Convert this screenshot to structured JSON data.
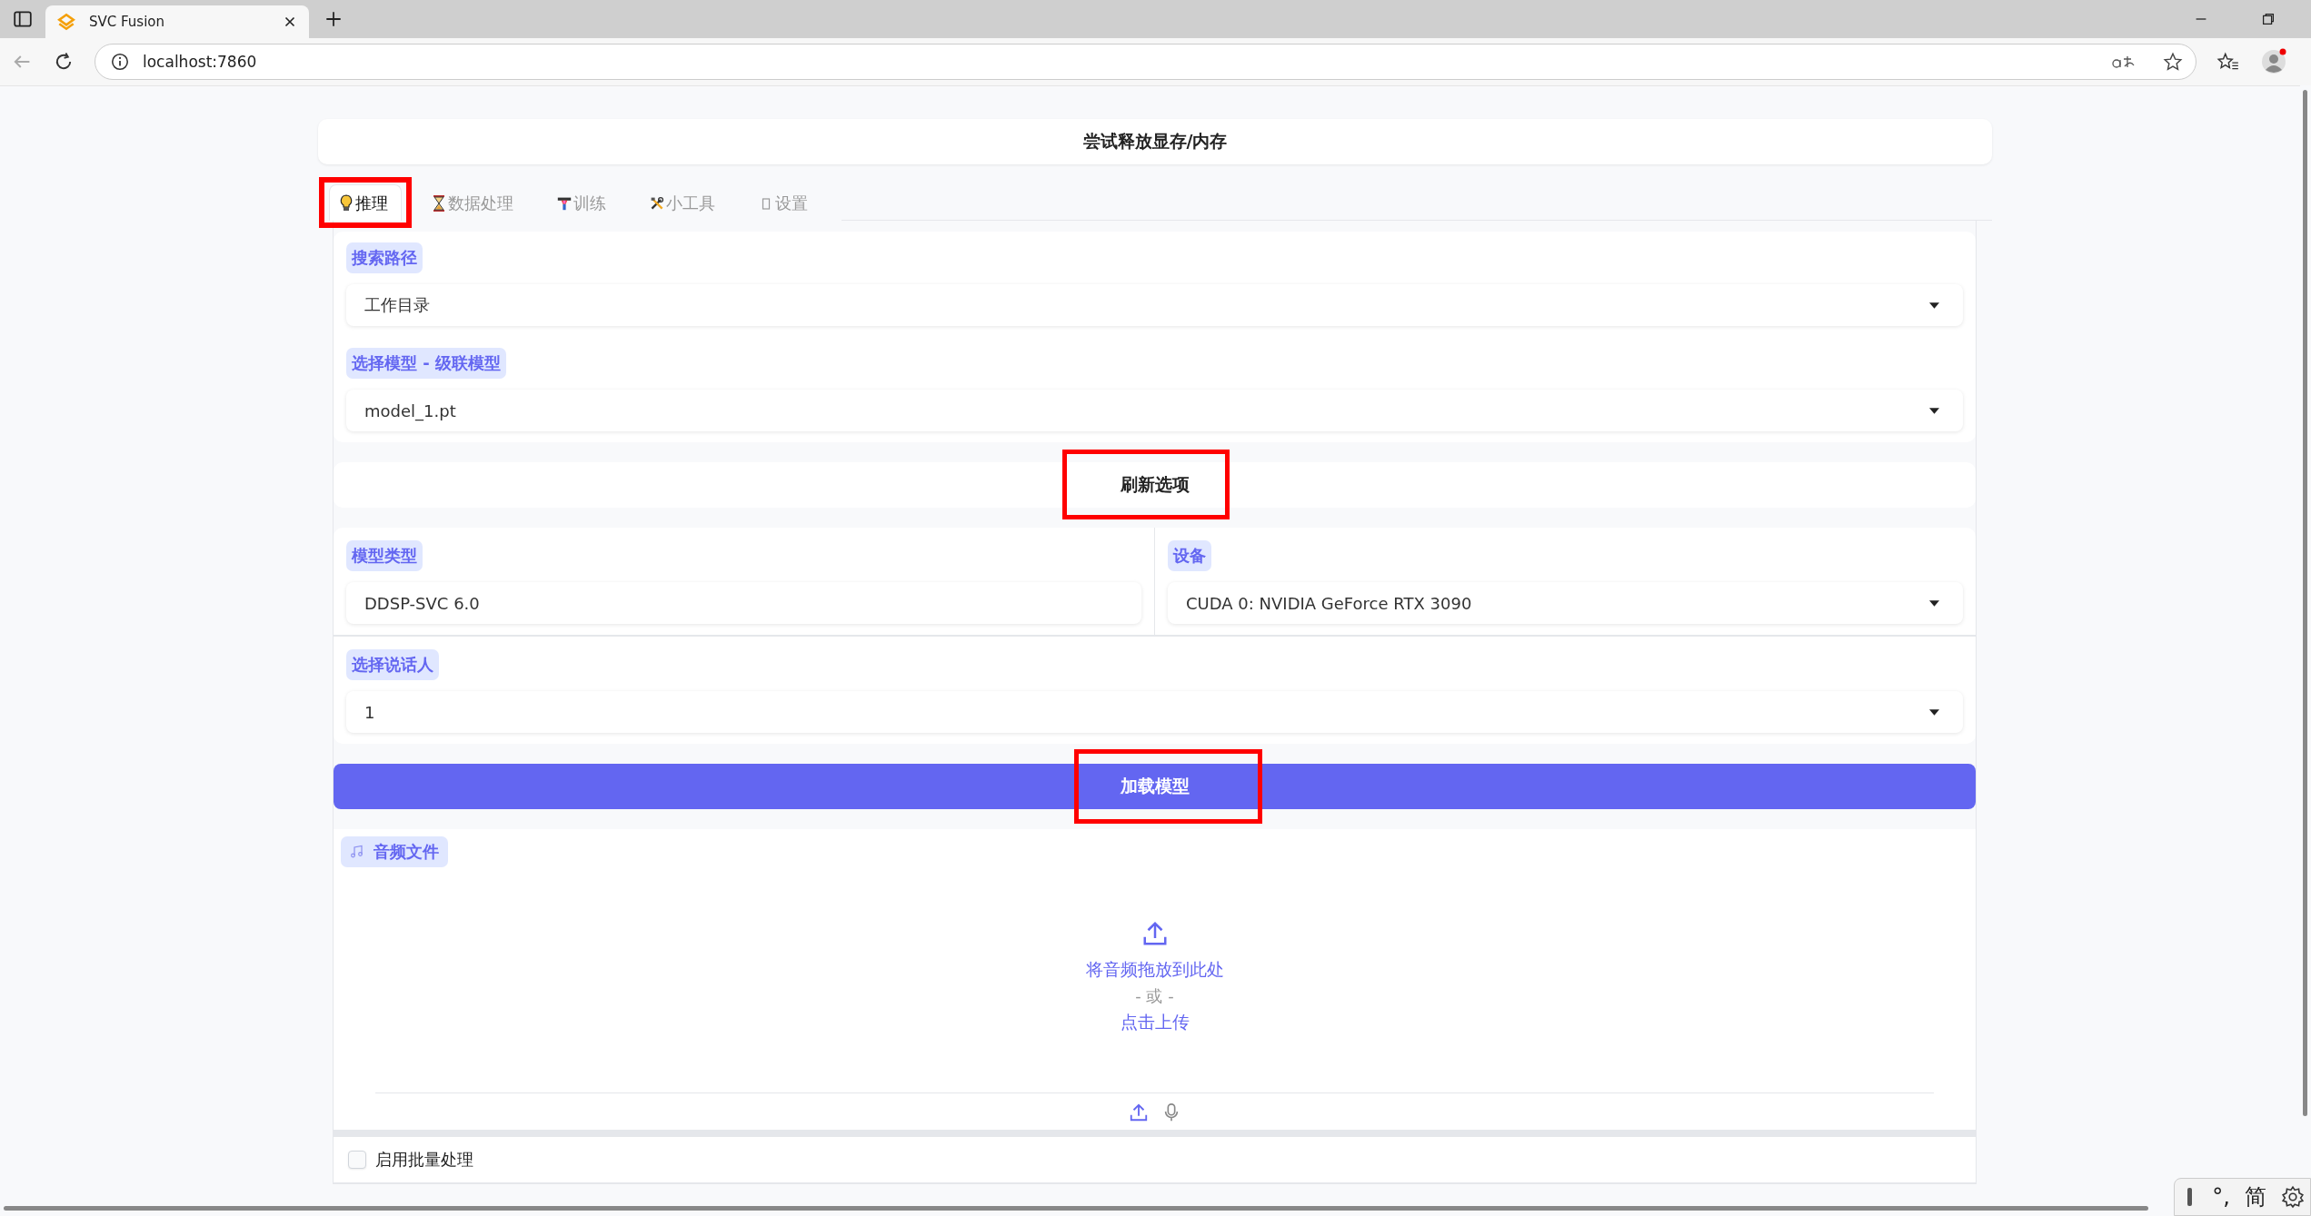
{
  "browser": {
    "tab_title": "SVC Fusion",
    "url": "localhost:7860"
  },
  "free_memory_button": {
    "label": "尝试释放显存/内存"
  },
  "tabs": [
    {
      "label": "推理",
      "selected": true,
      "highlighted": true
    },
    {
      "label": "数据处理",
      "selected": false,
      "highlighted": false
    },
    {
      "label": "训练",
      "selected": false,
      "highlighted": false
    },
    {
      "label": "小工具",
      "selected": false,
      "highlighted": false
    },
    {
      "label": "设置",
      "selected": false,
      "highlighted": false
    }
  ],
  "model_source": [
    {
      "label": "搜索路径",
      "value": "工作目录",
      "kind": "dropdown"
    },
    {
      "label": "选择模型 - 级联模型",
      "value": "model_1.pt",
      "kind": "dropdown"
    }
  ],
  "refresh_button": {
    "label": "刷新选项",
    "highlighted": true
  },
  "model_info": [
    {
      "label": "模型类型",
      "value": "DDSP-SVC 6.0",
      "kind": "text"
    },
    {
      "label": "设备",
      "value": "CUDA 0: NVIDIA GeForce RTX 3090",
      "kind": "dropdown"
    }
  ],
  "speaker": {
    "label": "选择说话人",
    "value": "1",
    "kind": "dropdown"
  },
  "load_button": {
    "label": "加载模型",
    "highlighted": true
  },
  "audio_upload": {
    "label": "音频文件",
    "drop_text": "将音频拖放到此处",
    "or_text": "- 或 -",
    "click_text": "点击上传"
  },
  "batch_checkbox": {
    "label": "启用批量处理",
    "checked": false
  },
  "ime": {
    "punctuation": "°,",
    "mode": "简"
  }
}
